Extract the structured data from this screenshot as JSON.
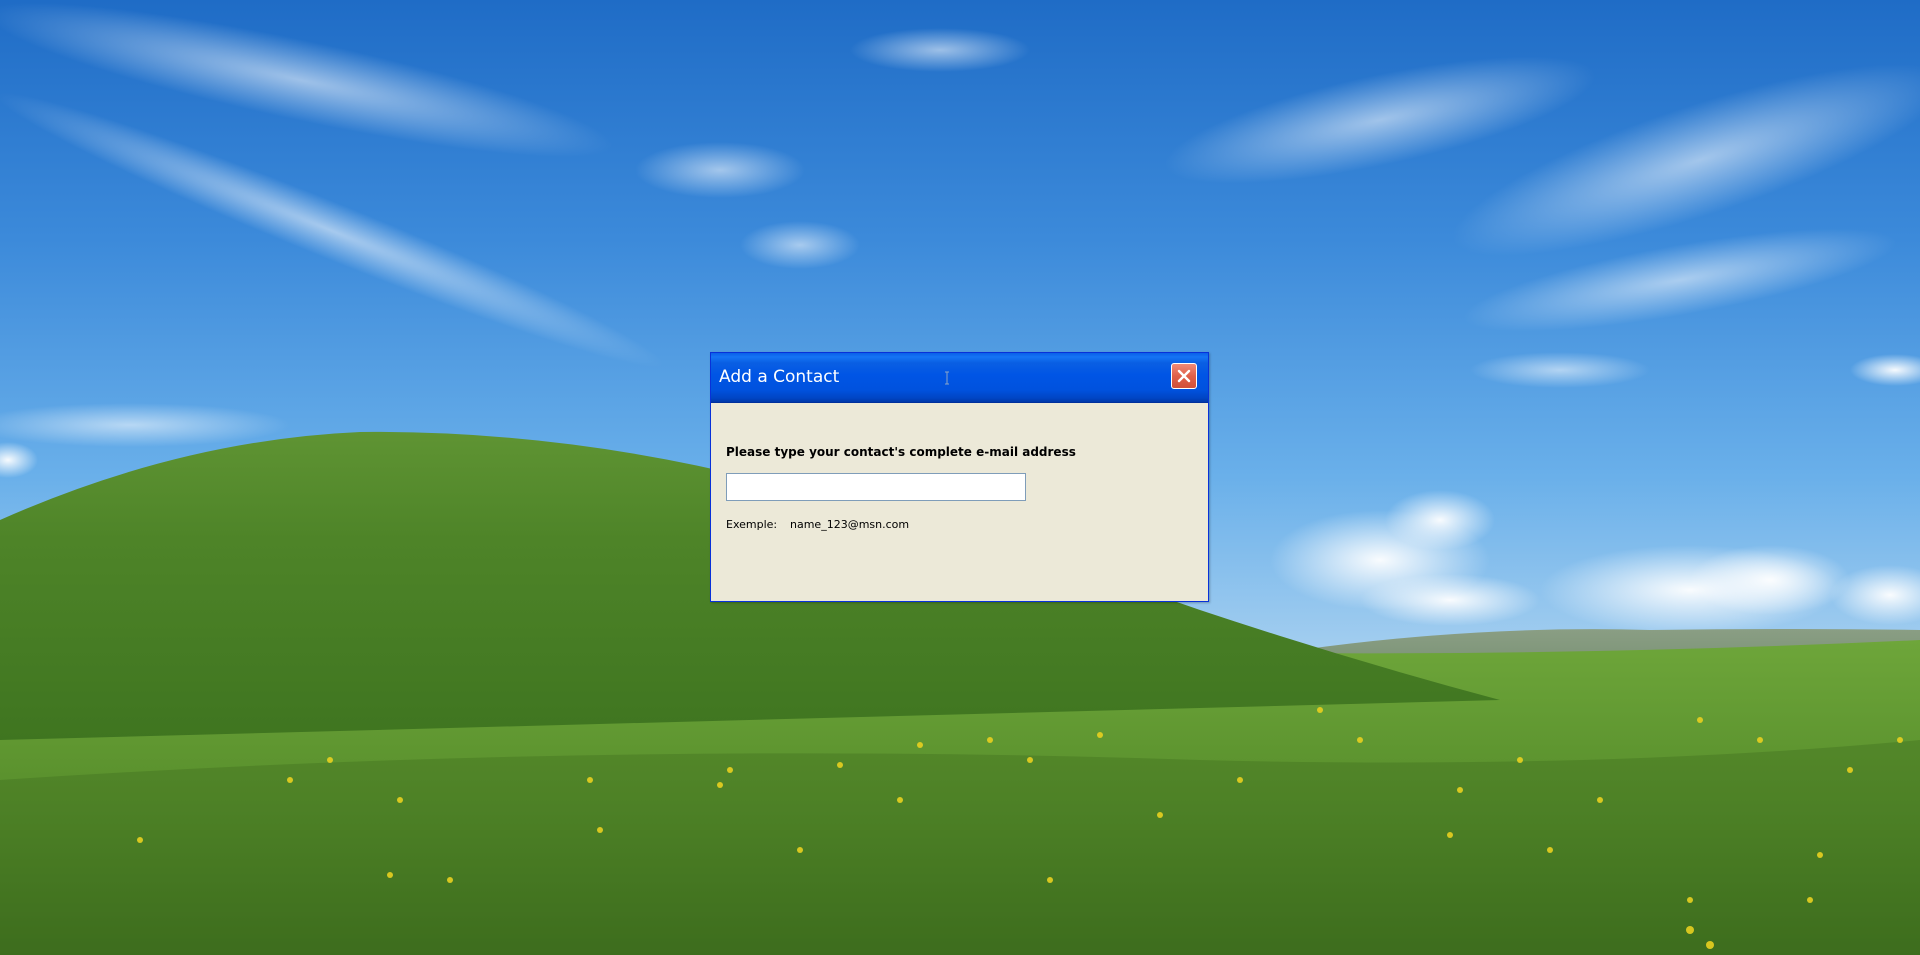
{
  "desktop": {
    "wallpaper": "bliss-hills",
    "sky_color": "#4A9BE0",
    "grass_color": "#5E9A2E"
  },
  "dialog": {
    "title": "Add a Contact",
    "close_icon": "close-x-icon",
    "prompt": "Please type your contact's complete e-mail address",
    "email_input": {
      "value": "",
      "placeholder": ""
    },
    "example_label": "Exemple:",
    "example_value": "name_123@msn.com"
  },
  "colors": {
    "titlebar": "#0055E5",
    "dialog_body": "#ECE9D8",
    "close_button": "#E0604A"
  }
}
